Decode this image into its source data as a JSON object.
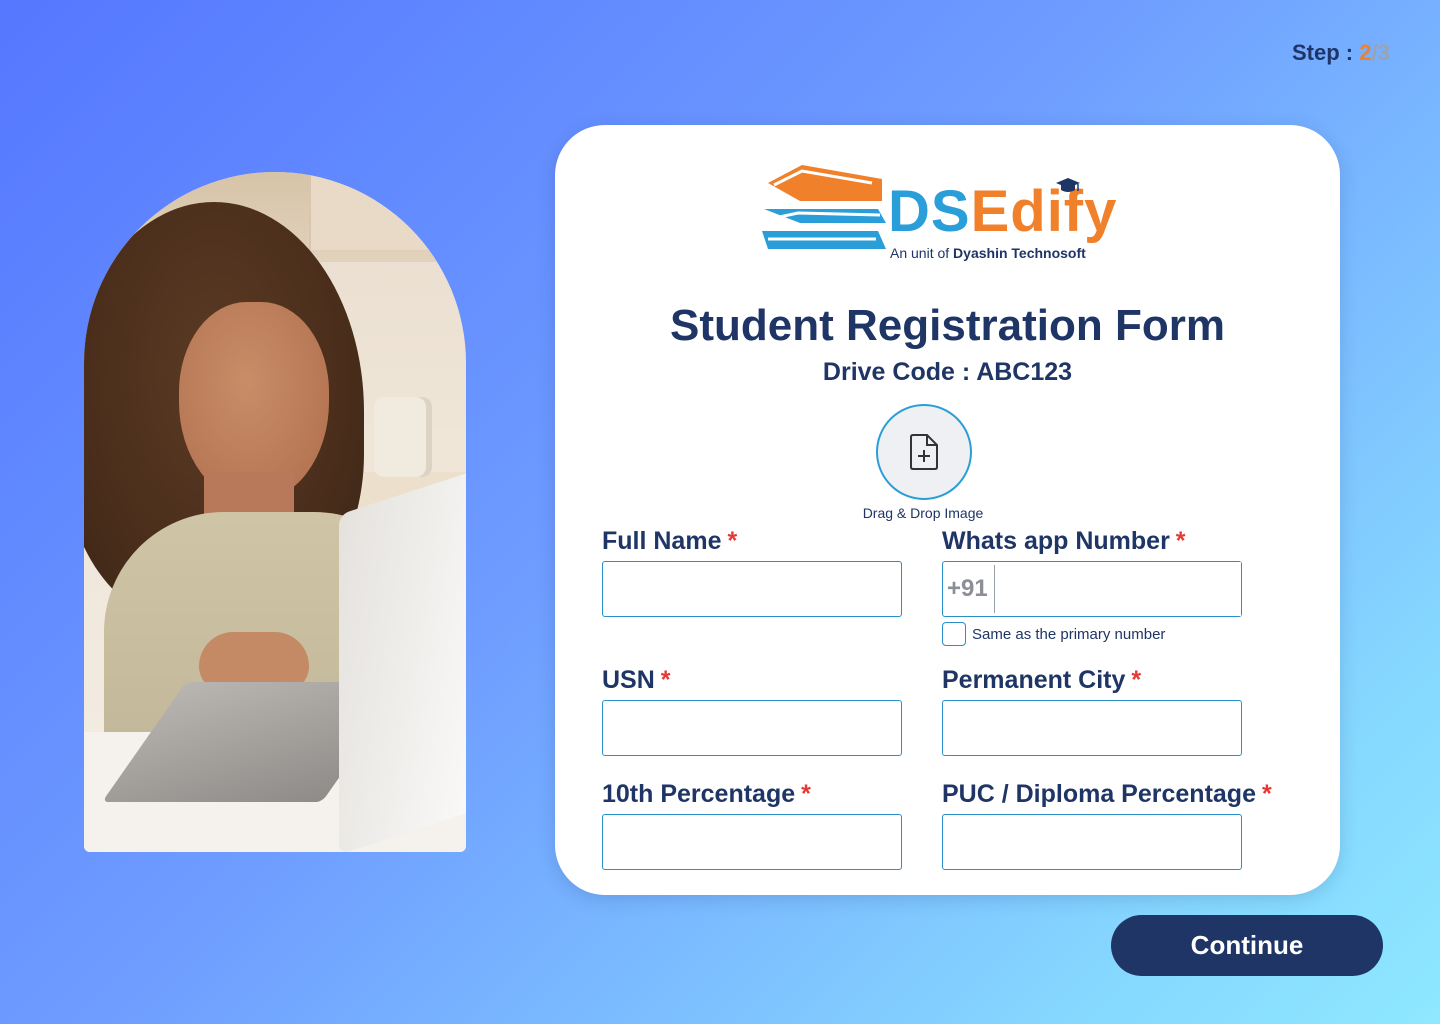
{
  "step": {
    "prefix": "Step : ",
    "current": "2",
    "separator": "/",
    "total": "3"
  },
  "brand": {
    "name_part1": "DS",
    "name_part2": "Edify",
    "tagline_prefix": "An unit of ",
    "tagline_company": "Dyashin Technosoft"
  },
  "form": {
    "title": "Student Registration Form",
    "drive_code": "Drive Code : ABC123",
    "upload_label": "Drag & Drop Image",
    "required_marker": "*",
    "fields": {
      "full_name": {
        "label": "Full Name",
        "value": ""
      },
      "whatsapp": {
        "label": "Whats app Number",
        "prefix": "+91",
        "value": ""
      },
      "same_as_primary": {
        "label": "Same as the primary number",
        "checked": false
      },
      "usn": {
        "label": "USN",
        "value": ""
      },
      "permanent_city": {
        "label": "Permanent City",
        "value": ""
      },
      "tenth_percentage": {
        "label": "10th Percentage",
        "value": ""
      },
      "puc_percentage": {
        "label": "PUC / Diploma Percentage",
        "value": ""
      }
    },
    "continue_label": "Continue"
  },
  "colors": {
    "primary": "#1f3566",
    "accent_orange": "#f0802a",
    "accent_blue": "#2a9ed8",
    "required": "#e53935"
  }
}
